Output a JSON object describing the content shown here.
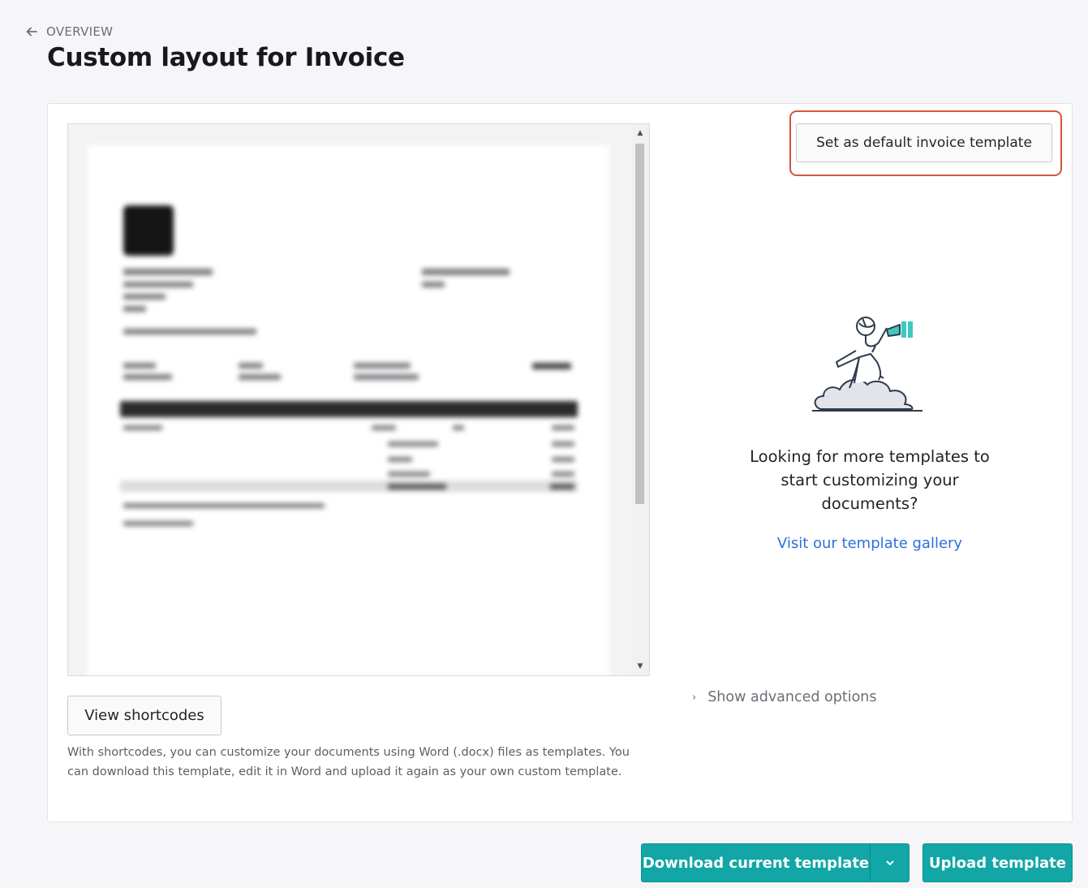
{
  "header": {
    "back_label": "OVERVIEW",
    "title": "Custom layout for Invoice"
  },
  "preview": {
    "scroll_up_icon": "▲",
    "scroll_down_icon": "▼"
  },
  "actions": {
    "set_default_label": "Set as default invoice template",
    "view_shortcodes_label": "View shortcodes",
    "download_label": "Download current template",
    "upload_label": "Upload template"
  },
  "help_text": "With shortcodes, you can customize your documents using Word (.docx) files as templates. You can download this template, edit it in Word and upload it again as your own custom template.",
  "promo": {
    "text": "Looking for more templates to start customizing your documents?",
    "link_label": "Visit our template gallery"
  },
  "advanced": {
    "label": "Show advanced options",
    "chevron": "›"
  },
  "colors": {
    "primary": "#12a6a6",
    "link": "#2f6fdc",
    "highlight": "#d4553f",
    "illustration_accent": "#3cc9c4"
  },
  "icons": {
    "back": "arrow-left-icon",
    "dropdown": "chevron-down-icon",
    "illustration": "explorer-on-cloud-with-telescope"
  }
}
